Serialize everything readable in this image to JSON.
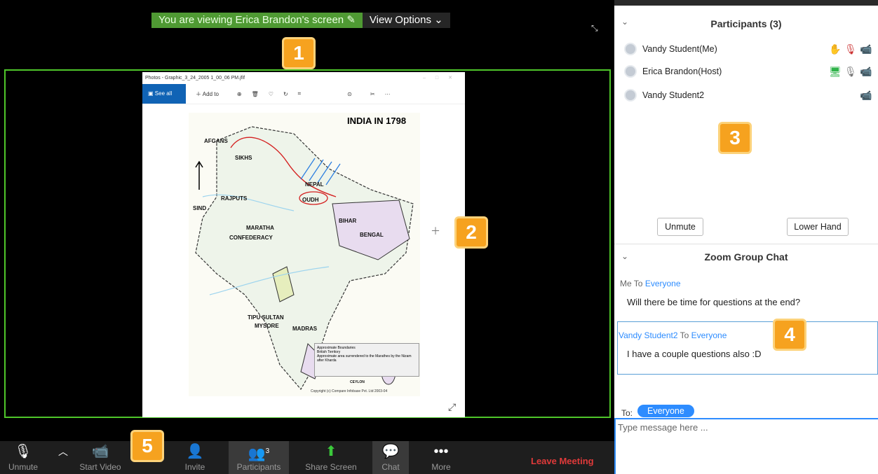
{
  "banner": {
    "viewing_text": "You are viewing Erica Brandon's screen",
    "view_options_label": "View Options"
  },
  "badges": [
    "1",
    "2",
    "3",
    "4",
    "5"
  ],
  "photos": {
    "window_title": "Photos - Graphic_3_24_2005 1_00_06 PM.jfif",
    "see_all_label": "See all photos",
    "add_to_label": "Add to"
  },
  "map": {
    "title": "INDIA IN 1798",
    "labels": [
      "AFGANS",
      "SIKHS",
      "RAJPUTS",
      "SIND",
      "MARATHA",
      "CONFEDERACY",
      "BENGAL",
      "BIHAR",
      "OUDH",
      "NEPAL",
      "TIPU SULTAN",
      "MYSORE",
      "MADRAS",
      "CEYLON"
    ],
    "legend": [
      "Approximate Boundaries",
      "British Territory",
      "Approximate area surrendered to the Marathes by the Nizam after Kharda"
    ],
    "copyright": "Copyright (c) Compare Infobase Pvt. Ltd 2003-04"
  },
  "toolbar": {
    "unmute": "Unmute",
    "start_video": "Start Video",
    "invite": "Invite",
    "participants": "Participants",
    "participants_count": "3",
    "share_screen": "Share Screen",
    "chat": "Chat",
    "more": "More",
    "leave": "Leave Meeting"
  },
  "participants": {
    "title": "Participants (3)",
    "list": [
      {
        "name": "Vandy Student(Me)"
      },
      {
        "name": "Erica Brandon(Host)"
      },
      {
        "name": "Vandy Student2"
      }
    ],
    "unmute_button": "Unmute",
    "lower_hand_button": "Lower Hand"
  },
  "chat": {
    "title": "Zoom Group Chat",
    "messages": [
      {
        "from": "Me",
        "to_word": "To",
        "to": "Everyone",
        "text": "Will there be time for questions at the end?"
      },
      {
        "from": "Vandy Student2",
        "to_word": "To",
        "to": "Everyone",
        "text": "I have a couple questions also :D"
      }
    ],
    "to_label": "To:",
    "to_value": "Everyone",
    "input_placeholder": "Type message here ..."
  },
  "colors": {
    "accent": "#2d8cff",
    "share_border": "#4fc62a",
    "badge": "#f6a21f",
    "leave": "#e03a3a"
  }
}
